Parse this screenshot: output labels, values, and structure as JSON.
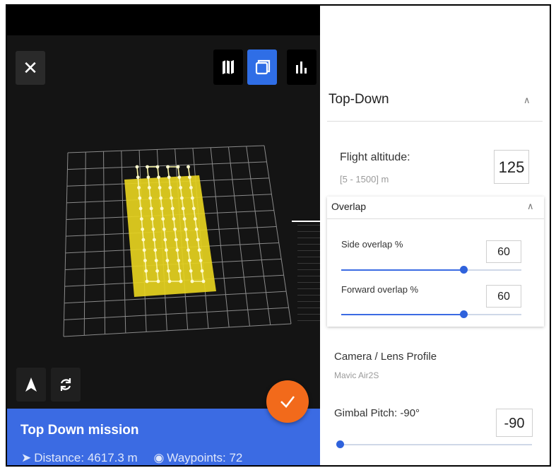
{
  "left_panel": {
    "view_buttons": [
      {
        "name": "map-view",
        "active": false
      },
      {
        "name": "3d-view",
        "active": true
      },
      {
        "name": "stats-view",
        "active": false
      }
    ],
    "mission": {
      "title": "Top Down mission",
      "distance": "Distance: 4617.3 m",
      "waypoints": "Waypoints: 72"
    },
    "colors": {
      "accent": "#3b6be3",
      "fab": "#f26a1b",
      "area": "#e6d21f"
    }
  },
  "settings": {
    "section_title": "Top-Down",
    "flight_altitude": {
      "label": "Flight altitude:",
      "range": "[5 - 1500] m",
      "value": "125"
    },
    "overlap": {
      "title": "Overlap",
      "side": {
        "label": "Side overlap %",
        "value": "60",
        "slider_pct": 0.68
      },
      "forward": {
        "label": "Forward overlap %",
        "value": "60",
        "slider_pct": 0.68
      }
    },
    "camera": {
      "label": "Camera / Lens Profile",
      "value": "Mavic Air2S"
    },
    "gimbal": {
      "label": "Gimbal Pitch: -90°",
      "value": "-90",
      "slider_pct": 0.0
    }
  }
}
